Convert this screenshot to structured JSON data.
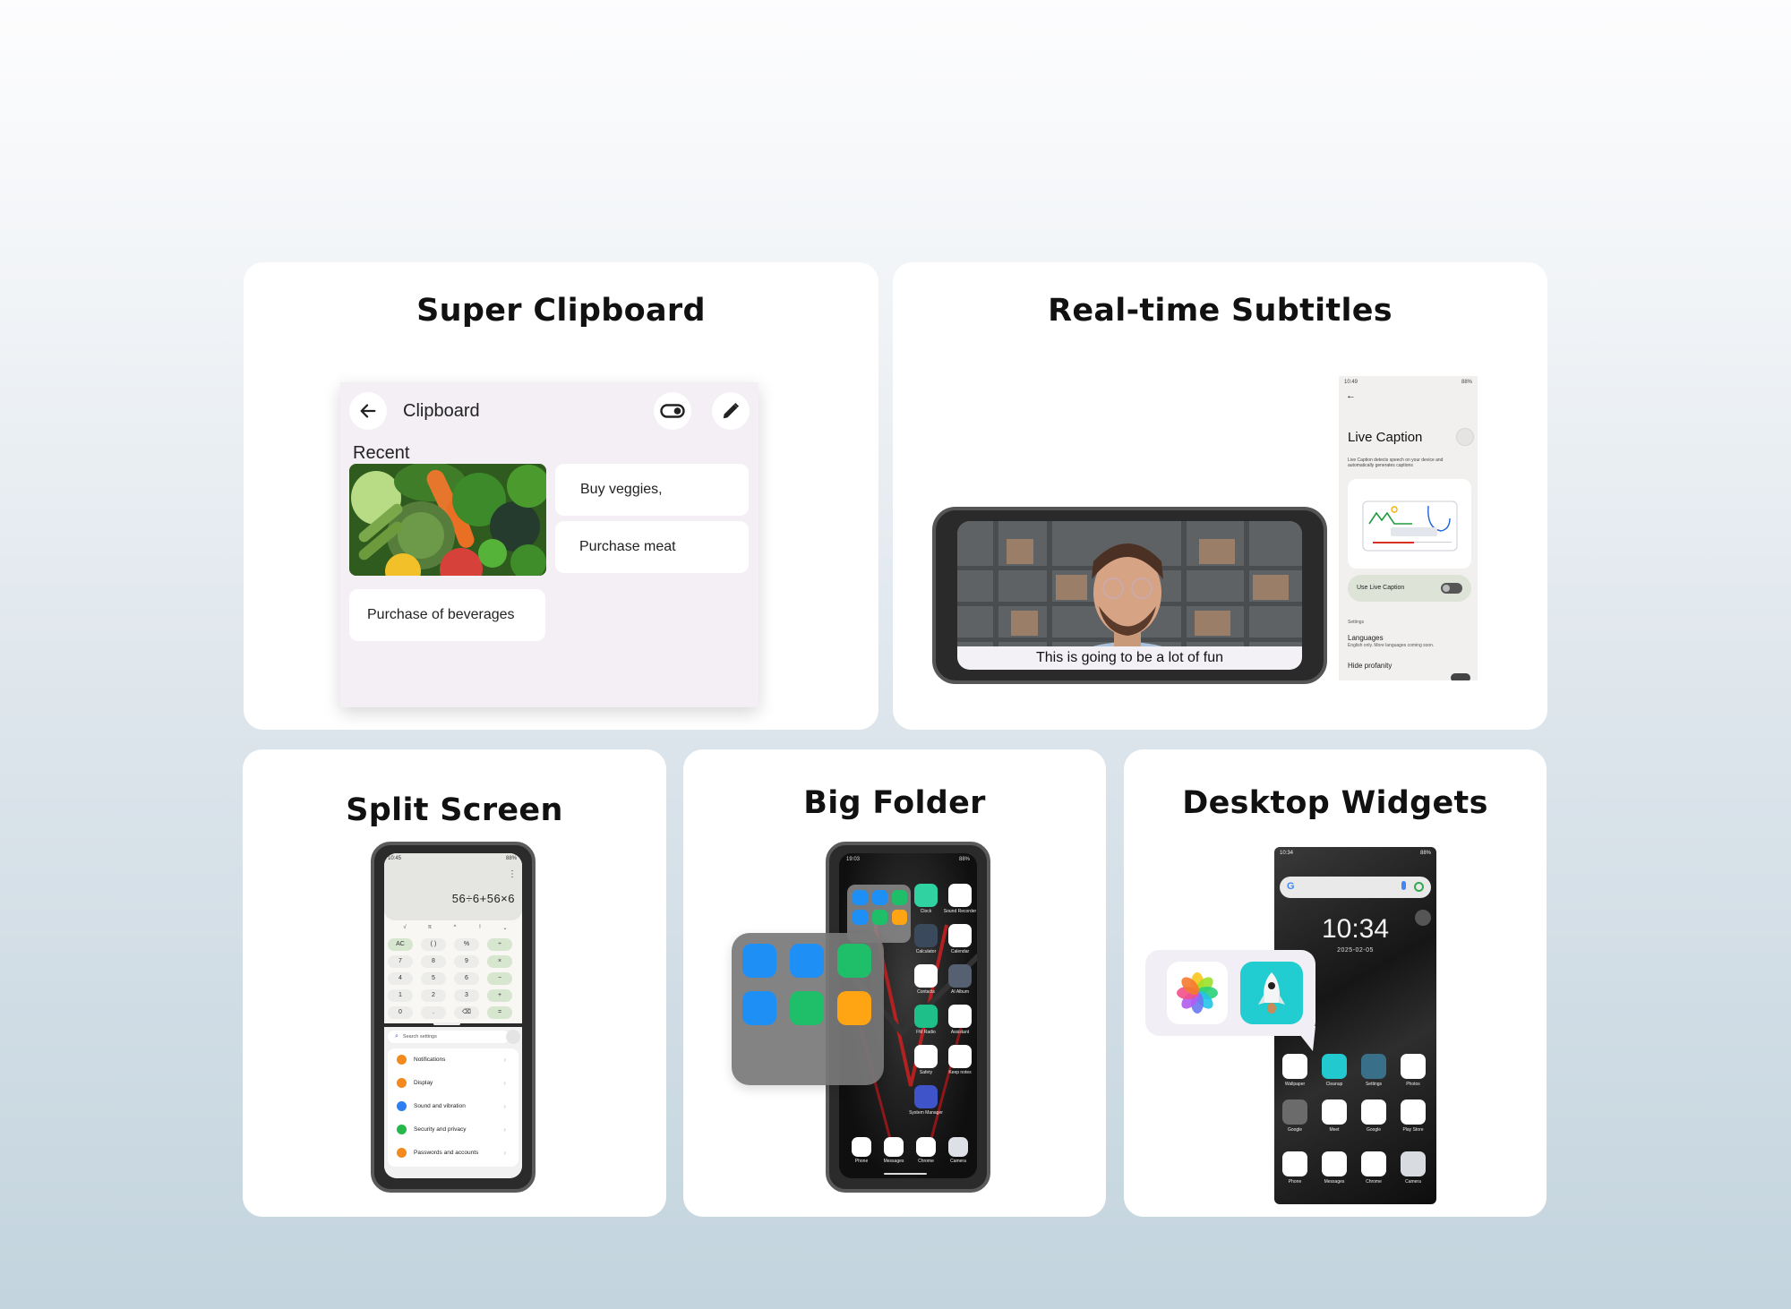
{
  "colors": {
    "background_top": "#fdfdfe",
    "background_bottom": "#c3d4de",
    "card": "#ffffff",
    "clipboard_panel": "#f3eff5",
    "caption_panel": "#f2f0ee",
    "caption_toggle_row": "#dde3d6",
    "calc_accent": "#d6e6cf",
    "folder_bg": "#7a7a7a",
    "cleanup_teal": "#21cdd0"
  },
  "cards": {
    "clipboard": {
      "title": "Super Clipboard",
      "panel": {
        "back_icon": "arrow-left-icon",
        "header_title": "Clipboard",
        "toggle_icon": "toggle-icon",
        "edit_icon": "pencil-icon",
        "section_label": "Recent",
        "image_item": "vegetables-photo",
        "items": [
          "Buy veggies,",
          "Purchase meat",
          "Purchase of beverages"
        ]
      }
    },
    "subtitles": {
      "title": "Real-time Subtitles",
      "video_caption": "This is going to be a lot of fun",
      "settings": {
        "status_time": "10:49",
        "status_battery": "88%",
        "heading": "Live Caption",
        "description": "Live Caption detects speech on your device and automatically generates captions",
        "toggle_label": "Use Live Caption",
        "toggle_on": false,
        "section": "Settings",
        "languages_title": "Languages",
        "languages_sub": "English only. More languages coming soon.",
        "hide_profanity": "Hide profanity"
      }
    },
    "split": {
      "title": "Split Screen",
      "status_time": "10:45",
      "status_battery": "88%",
      "calculator": {
        "expression": "56÷6+56×6",
        "sci_row": [
          "√",
          "π",
          "^",
          "!",
          "⌄"
        ],
        "keys": [
          [
            "AC",
            "( )",
            "%",
            "÷"
          ],
          [
            "7",
            "8",
            "9",
            "×"
          ],
          [
            "4",
            "5",
            "6",
            "−"
          ],
          [
            "1",
            "2",
            "3",
            "+"
          ],
          [
            "0",
            ".",
            "⌫",
            "="
          ]
        ]
      },
      "settings": {
        "search_placeholder": "Search settings",
        "items": [
          {
            "label": "Notifications",
            "color": "#f28a1d"
          },
          {
            "label": "Display",
            "color": "#f28a1d"
          },
          {
            "label": "Sound and vibration",
            "color": "#2d7ef0"
          },
          {
            "label": "Security and privacy",
            "color": "#25b84a"
          },
          {
            "label": "Passwords and accounts",
            "color": "#f28a1d"
          }
        ]
      }
    },
    "folder": {
      "title": "Big Folder",
      "status_time": "19:03",
      "status_battery": "88%",
      "folder_apps": [
        {
          "icon": "toolbox-icon",
          "color": "#1e8ff5"
        },
        {
          "icon": "scan-icon",
          "color": "#1e8ff5"
        },
        {
          "icon": "smiley-icon",
          "color": "#1fbf6a"
        },
        {
          "icon": "gamepad-icon",
          "color": "#1e8ff5"
        },
        {
          "icon": "widgets-icon",
          "color": "#1fbf6a"
        },
        {
          "icon": "sim-card-icon",
          "color": "#ffa412"
        }
      ],
      "home_apps": [
        {
          "label": "Clock",
          "color": "#2fd2a0"
        },
        {
          "label": "Sound Recorder",
          "color": "#ffffff"
        },
        {
          "label": "Calculator",
          "color": "#3a4a5c"
        },
        {
          "label": "Calendar",
          "color": "#ffffff"
        },
        {
          "label": "Contacts",
          "color": "#ffffff"
        },
        {
          "label": "AI Album",
          "color": "#556070"
        },
        {
          "label": "FM Radio",
          "color": "#1fbf8a"
        },
        {
          "label": "Assistant",
          "color": "#ffffff"
        },
        {
          "label": "Safety",
          "color": "#ffffff"
        },
        {
          "label": "Keep notes",
          "color": "#ffffff"
        },
        {
          "label": "System Manager",
          "color": "#3f54c8"
        }
      ],
      "dock": [
        "Phone",
        "Messages",
        "Chrome",
        "Camera"
      ]
    },
    "widgets": {
      "title": "Desktop Widgets",
      "status_time": "10:34",
      "status_battery": "88%",
      "clock_time": "10:34",
      "clock_date": "2025-02-05",
      "popup_apps": [
        "photos-flower-icon",
        "rocket-cleanup-icon"
      ],
      "grid": [
        [
          "Wallpaper",
          "Cleanup",
          "Settings",
          "Photos"
        ],
        [
          "Google",
          "Meet",
          "Google",
          "Play Store"
        ],
        [
          "Phone",
          "Messages",
          "Chrome",
          "Camera"
        ]
      ]
    }
  }
}
